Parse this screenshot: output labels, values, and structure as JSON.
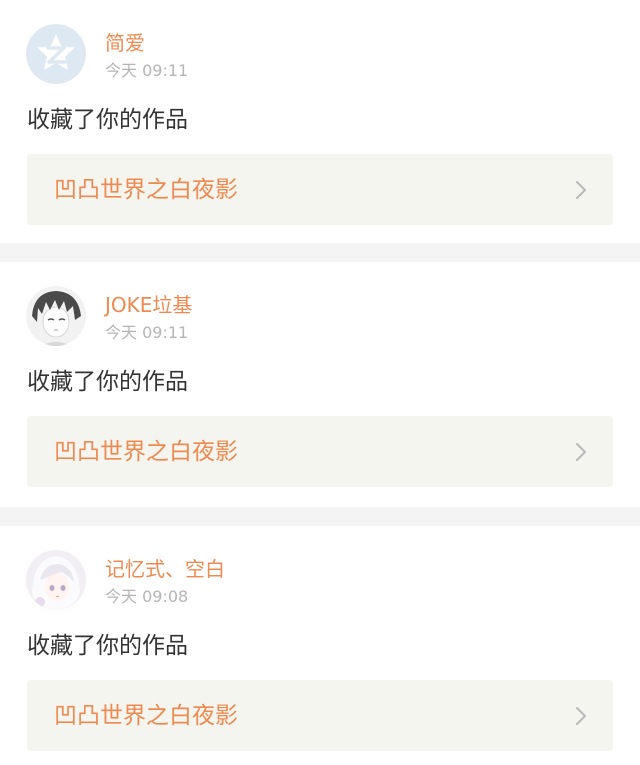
{
  "notifications": [
    {
      "username": "简爱",
      "timestamp": "今天 09:11",
      "action": "收藏了你的作品",
      "work_title": "凹凸世界之白夜影",
      "avatar_icon": "qzone-default-avatar-icon"
    },
    {
      "username": "JOKE垃基",
      "timestamp": "今天 09:11",
      "action": "收藏了你的作品",
      "work_title": "凹凸世界之白夜影",
      "avatar_icon": "anime-boy-avatar-icon"
    },
    {
      "username": "记忆式、空白",
      "timestamp": "今天 09:08",
      "action": "收藏了你的作品",
      "work_title": "凹凸世界之白夜影",
      "avatar_icon": "anime-girl-avatar-icon"
    }
  ],
  "colors": {
    "accent": "#ee8a50",
    "timestamp": "#b5b5b5",
    "body_text": "#333333",
    "link_bg": "#f5f5f0",
    "separator": "#f4f4f4"
  }
}
